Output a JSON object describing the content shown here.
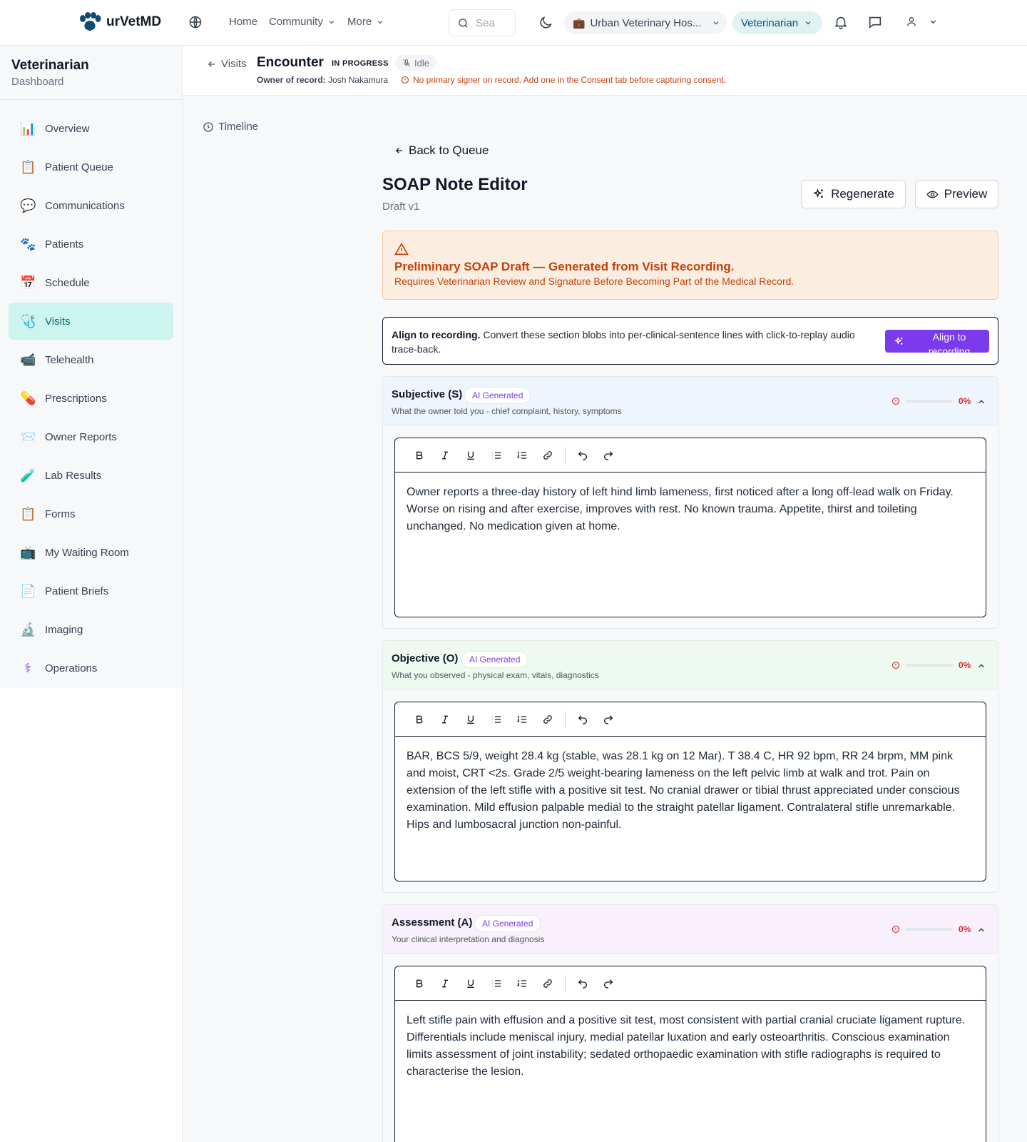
{
  "nav": {
    "brand": "urVetMD",
    "links": {
      "home": "Home",
      "community": "Community",
      "more": "More"
    },
    "search_placeholder": "Sea",
    "clinic": "Urban Veterinary Hos...",
    "role": "Veterinarian"
  },
  "sidebar": {
    "title": "Veterinarian",
    "subtitle": "Dashboard",
    "items": [
      {
        "label": "Overview",
        "icon": "📊"
      },
      {
        "label": "Patient Queue",
        "icon": "📋"
      },
      {
        "label": "Communications",
        "icon": "💬"
      },
      {
        "label": "Patients",
        "icon": "🐾"
      },
      {
        "label": "Schedule",
        "icon": "📅"
      },
      {
        "label": "Visits",
        "icon": "🩺"
      },
      {
        "label": "Telehealth",
        "icon": "📹"
      },
      {
        "label": "Prescriptions",
        "icon": "💊"
      },
      {
        "label": "Owner Reports",
        "icon": "📨"
      },
      {
        "label": "Lab Results",
        "icon": "🧪"
      },
      {
        "label": "Forms",
        "icon": "📋"
      },
      {
        "label": "My Waiting Room",
        "icon": "📺"
      },
      {
        "label": "Patient Briefs",
        "icon": "📄"
      },
      {
        "label": "Imaging",
        "icon": "🔬"
      },
      {
        "label": "Operations",
        "icon": "⚕"
      }
    ],
    "active_item": "Visits"
  },
  "encounter": {
    "back_label": "Visits",
    "title": "Encounter",
    "status": "IN PROGRESS",
    "recording_state": "Idle",
    "owner_label": "Owner of record:",
    "owner_name": "Josh Nakamura",
    "warning": "No primary signer on record. Add one in the Consent tab before capturing consent."
  },
  "timeline_label": "Timeline",
  "editor_page": {
    "back_label": "Back to Queue",
    "title": "SOAP Note Editor",
    "version": "Draft v1",
    "regenerate_label": "Regenerate",
    "preview_label": "Preview"
  },
  "draft_banner": {
    "title": "Preliminary SOAP Draft — Generated from Visit Recording.",
    "subtitle": "Requires Veterinarian Review and Signature Before Becoming Part of the Medical Record."
  },
  "align": {
    "heading": "Align to recording.",
    "text": "Convert these section blobs into per-clinical-sentence lines with click-to-replay audio trace-back.",
    "button_label": "Align to recording"
  },
  "sections": [
    {
      "title": "Subjective (S)",
      "badge": "AI Generated",
      "description": "What the owner told you - chief complaint, history, symptoms",
      "progress": 0,
      "progress_label": "0%",
      "content": "Owner reports a three-day history of left hind limb lameness, first noticed after a long off-lead walk on Friday. Worse on rising and after exercise, improves with rest. No known trauma. Appetite, thirst and toileting unchanged. No medication given at home."
    },
    {
      "title": "Objective (O)",
      "badge": "AI Generated",
      "description": "What you observed - physical exam, vitals, diagnostics",
      "progress": 0,
      "progress_label": "0%",
      "content": "BAR, BCS 5/9, weight 28.4 kg (stable, was 28.1 kg on 12 Mar). T 38.4 C, HR 92 bpm, RR 24 brpm, MM pink and moist, CRT <2s. Grade 2/5 weight-bearing lameness on the left pelvic limb at walk and trot. Pain on extension of the left stifle with a positive sit test. No cranial drawer or tibial thrust appreciated under conscious examination. Mild effusion palpable medial to the straight patellar ligament. Contralateral stifle unremarkable. Hips and lumbosacral junction non-painful."
    },
    {
      "title": "Assessment (A)",
      "badge": "AI Generated",
      "description": "Your clinical interpretation and diagnosis",
      "progress": 0,
      "progress_label": "0%",
      "content": "Left stifle pain with effusion and a positive sit test, most consistent with partial cranial cruciate ligament rupture. Differentials include meniscal injury, medial patellar luxation and early osteoarthritis. Conscious examination limits assessment of joint instability; sedated orthopaedic examination with stifle radiographs is required to characterise the lesion."
    }
  ],
  "colors": {
    "brand": "#0f4c6e",
    "accent_purple": "#7c3aed",
    "warning": "#c2410c",
    "danger": "#dc2626",
    "active_nav_bg": "#cdf5f0",
    "subjective_bg": "#eef5fd",
    "objective_bg": "#eefaf1",
    "assessment_bg": "#f8f1fb"
  }
}
